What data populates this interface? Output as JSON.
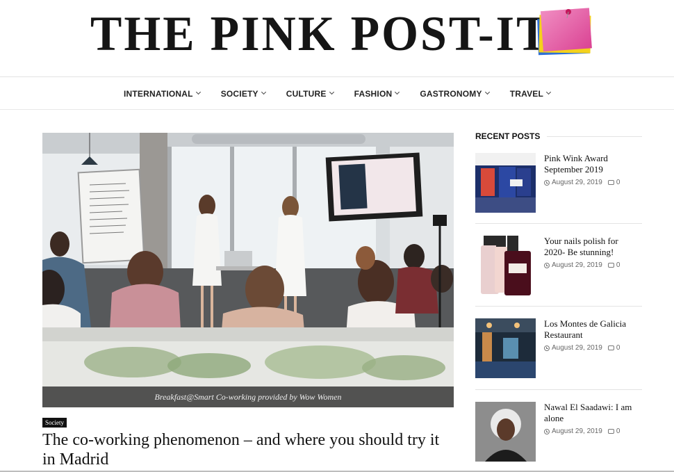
{
  "site": {
    "title": "THE PINK POST-IT"
  },
  "nav": {
    "items": [
      {
        "label": "INTERNATIONAL"
      },
      {
        "label": "SOCIETY"
      },
      {
        "label": "CULTURE"
      },
      {
        "label": "FASHION"
      },
      {
        "label": "GASTRONOMY"
      },
      {
        "label": "TRAVEL"
      }
    ]
  },
  "featured": {
    "caption": "Breakfast@Smart Co-working provided by Wow Women",
    "category": "Society",
    "title": "The co-working phenomenon – and where you should try it in Madrid"
  },
  "sidebar": {
    "heading": "RECENT POSTS",
    "posts": [
      {
        "title": "Pink Wink Award September 2019",
        "date": "August 29, 2019",
        "comments": "0"
      },
      {
        "title": "Your nails polish for 2020- Be stunning!",
        "date": "August 29, 2019",
        "comments": "0"
      },
      {
        "title": "Los Montes de Galicia Restaurant",
        "date": "August 29, 2019",
        "comments": "0"
      },
      {
        "title": "Nawal El Saadawi: I am alone",
        "date": "August 29, 2019",
        "comments": "0"
      }
    ]
  },
  "icons": [
    "pink-post-it-icon",
    "chevron-down-icon",
    "clock-icon",
    "comment-icon"
  ],
  "colors": {
    "postit_pink": "#e84fa0",
    "postit_yellow": "#f4d21c",
    "postit_blue": "#2f6fd6",
    "text": "#111111"
  }
}
